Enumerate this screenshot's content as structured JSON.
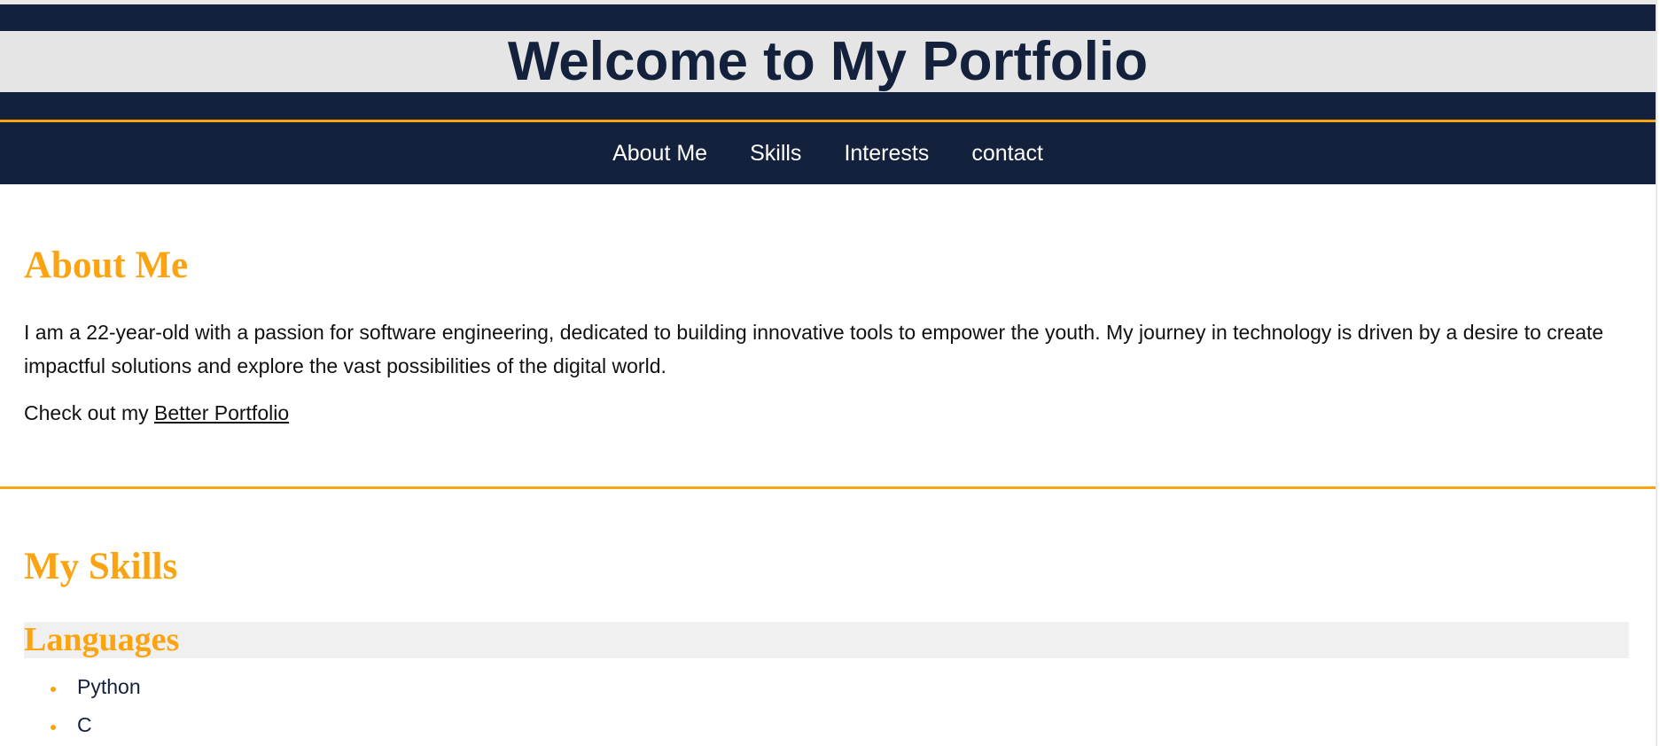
{
  "header": {
    "title": "Welcome to My Portfolio"
  },
  "nav": {
    "items": [
      {
        "label": "About Me"
      },
      {
        "label": "Skills"
      },
      {
        "label": "Interests"
      },
      {
        "label": "contact"
      }
    ]
  },
  "about": {
    "heading": "About Me",
    "text": "I am a 22-year-old with a passion for software engineering, dedicated to building innovative tools to empower the youth. My journey in technology is driven by a desire to create impactful solutions and explore the vast possibilities of the digital world.",
    "portfolio_prefix": "Check out my ",
    "portfolio_link": "Better Portfolio"
  },
  "skills": {
    "heading": "My Skills",
    "languages_heading": "Languages",
    "languages": [
      "Python",
      "C"
    ]
  },
  "colors": {
    "navy": "#14213d",
    "accent": "#fca311",
    "band": "#e5e5e5"
  }
}
